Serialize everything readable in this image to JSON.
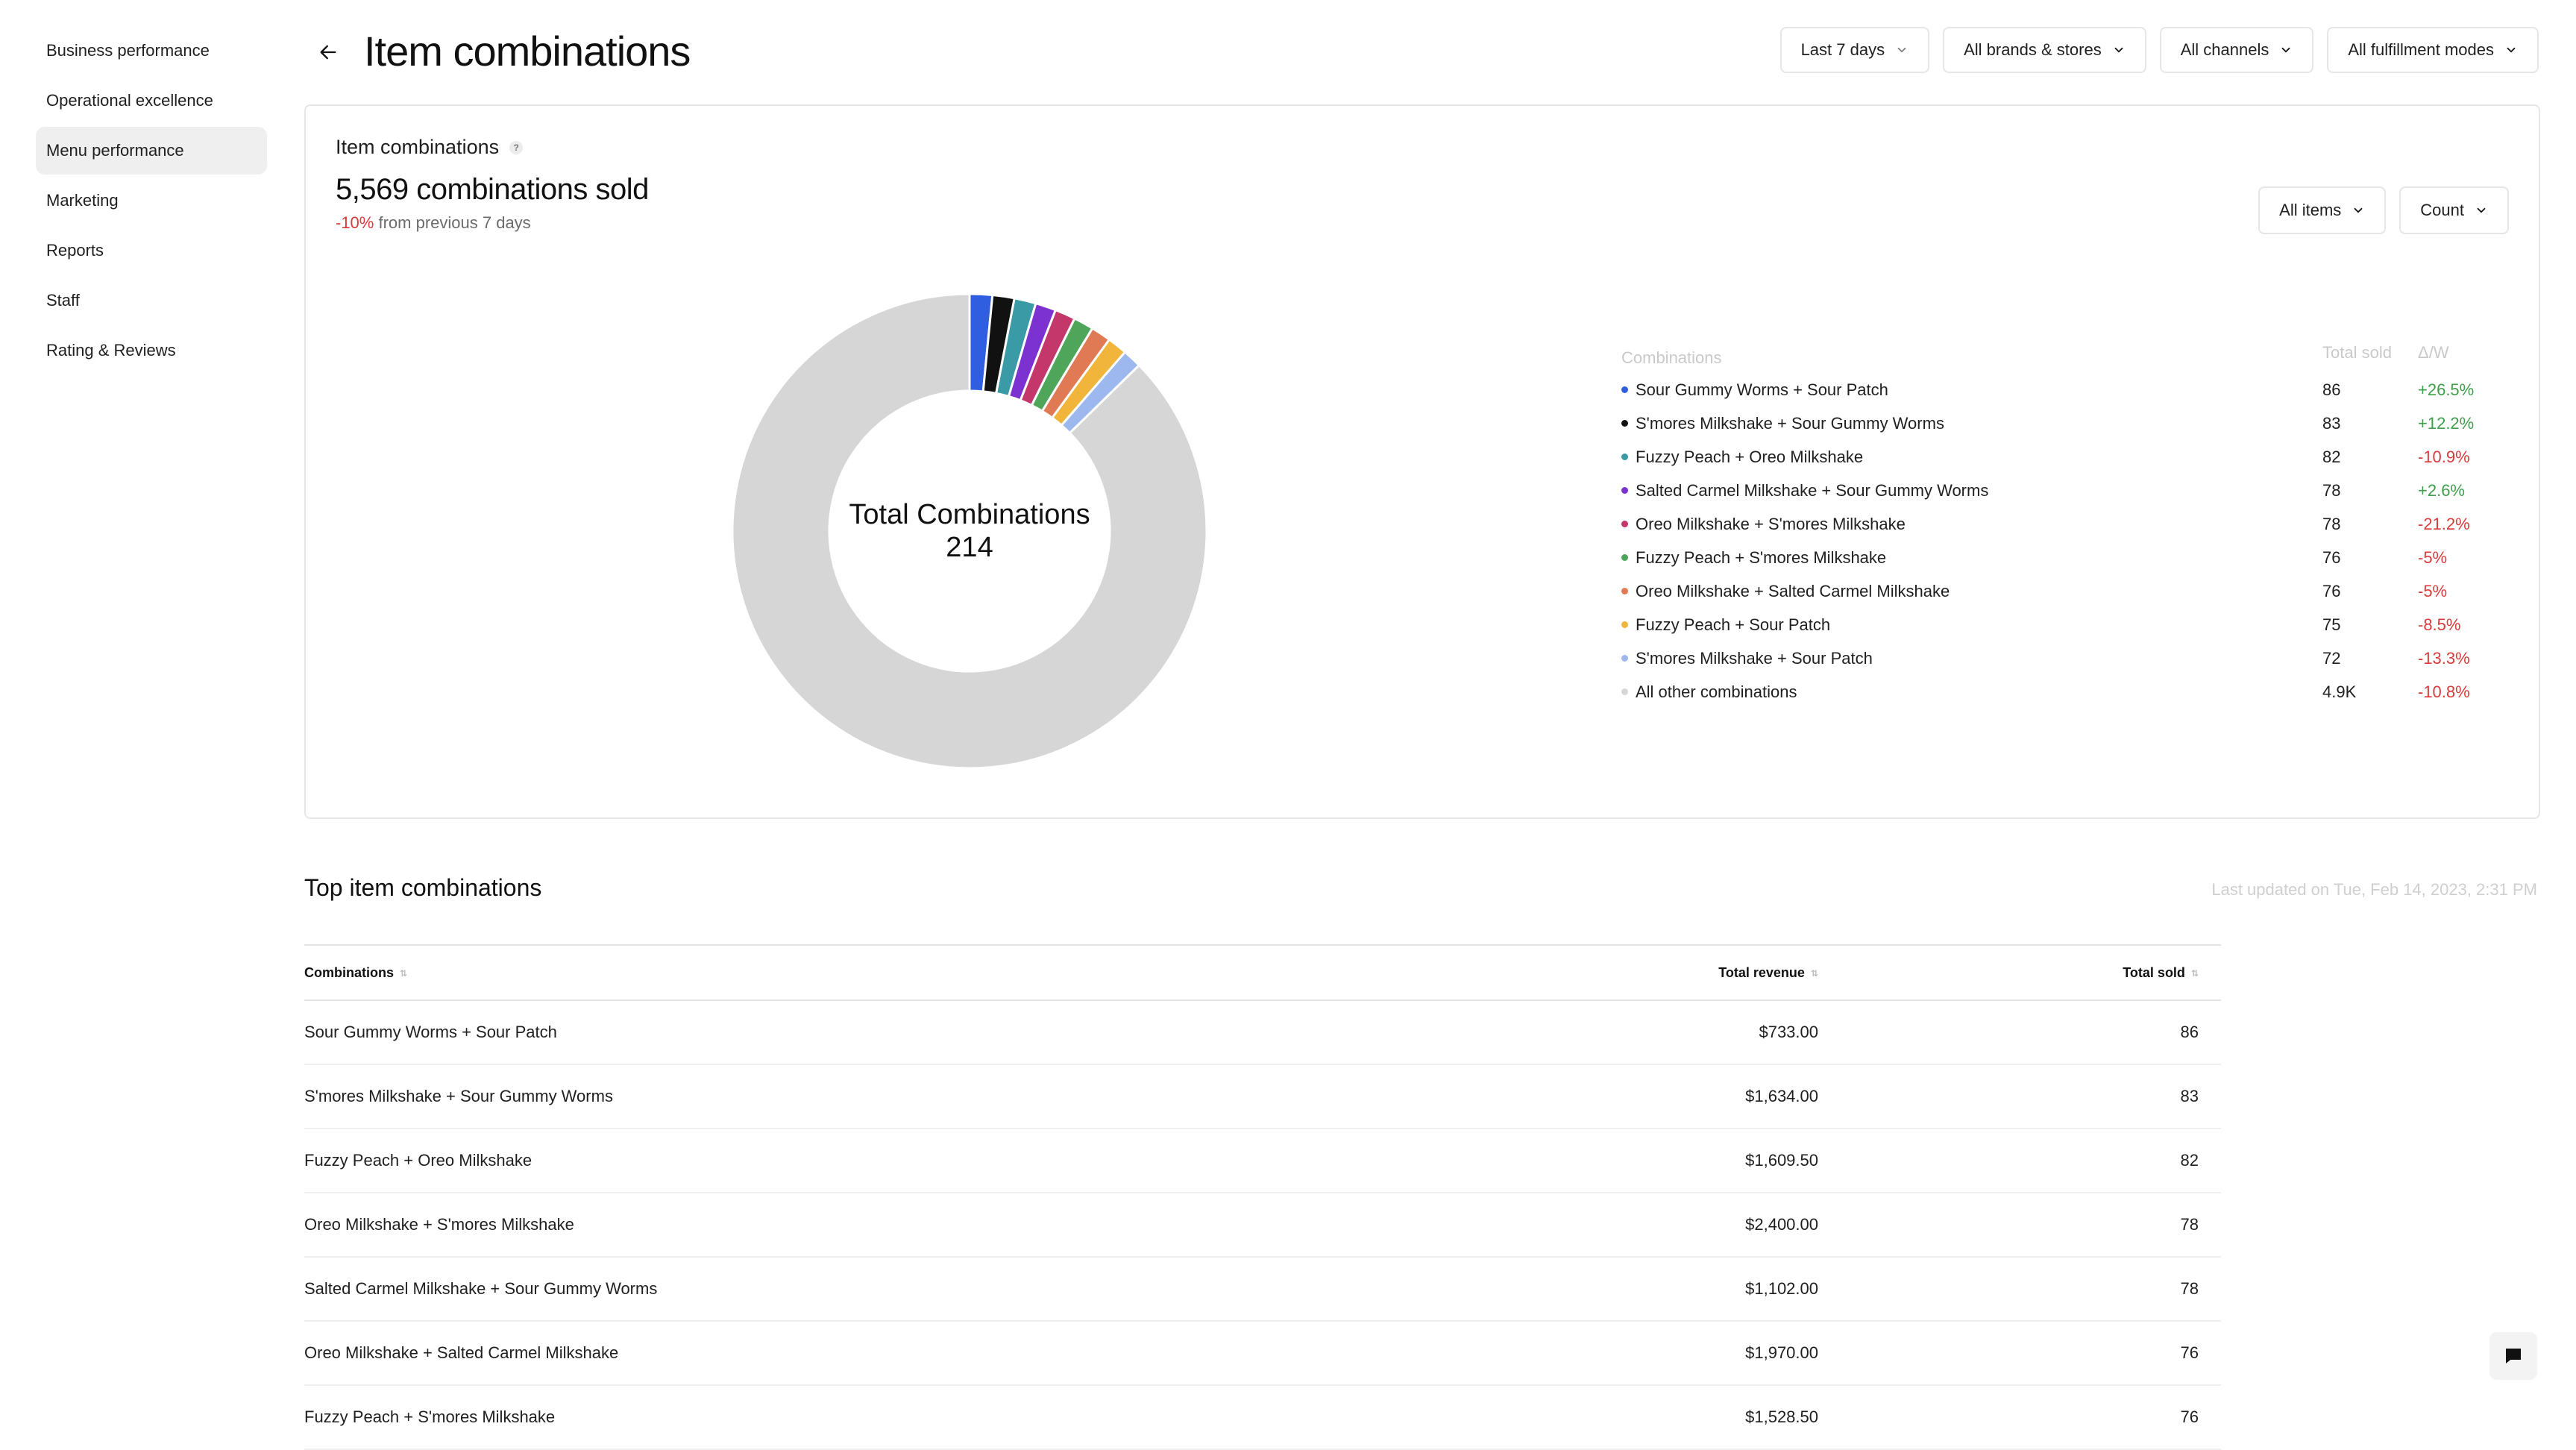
{
  "sidebar": {
    "items": [
      {
        "label": "Business performance"
      },
      {
        "label": "Operational excellence"
      },
      {
        "label": "Menu performance",
        "active": true
      },
      {
        "label": "Marketing"
      },
      {
        "label": "Reports"
      },
      {
        "label": "Staff"
      },
      {
        "label": "Rating & Reviews"
      }
    ]
  },
  "header": {
    "title": "Item combinations",
    "filters": [
      "Last 7 days",
      "All brands & stores",
      "All channels",
      "All fulfillment modes"
    ]
  },
  "card": {
    "title": "Item combinations",
    "help_icon": "question-icon",
    "headline": "5,569 combinations sold",
    "change": "-10%",
    "change_suffix": "from previous 7 days",
    "controls": [
      "All items",
      "Count"
    ],
    "donut": {
      "center_label": "Total Combinations",
      "center_value": "214"
    },
    "legend": {
      "headers": {
        "name": "Combinations",
        "sold": "Total sold",
        "delta": "Δ/W"
      },
      "rows": [
        {
          "name": "Sour Gummy Worms + Sour Patch",
          "sold": "86",
          "delta": "+26.5%",
          "color": "#2f5fe0",
          "value": 86
        },
        {
          "name": "S'mores Milkshake + Sour Gummy Worms",
          "sold": "83",
          "delta": "+12.2%",
          "color": "#111111",
          "value": 83
        },
        {
          "name": "Fuzzy Peach + Oreo Milkshake",
          "sold": "82",
          "delta": "-10.9%",
          "color": "#3a9aa6",
          "value": 82
        },
        {
          "name": "Salted Carmel Milkshake + Sour Gummy Worms",
          "sold": "78",
          "delta": "+2.6%",
          "color": "#7b32d0",
          "value": 78
        },
        {
          "name": "Oreo Milkshake + S'mores Milkshake",
          "sold": "78",
          "delta": "-21.2%",
          "color": "#c4376b",
          "value": 78
        },
        {
          "name": "Fuzzy Peach + S'mores Milkshake",
          "sold": "76",
          "delta": "-5%",
          "color": "#4fa65a",
          "value": 76
        },
        {
          "name": "Oreo Milkshake + Salted Carmel Milkshake",
          "sold": "76",
          "delta": "-5%",
          "color": "#e07a55",
          "value": 76
        },
        {
          "name": "Fuzzy Peach + Sour Patch",
          "sold": "75",
          "delta": "-8.5%",
          "color": "#f2b53c",
          "value": 75
        },
        {
          "name": "S'mores Milkshake + Sour Patch",
          "sold": "72",
          "delta": "-13.3%",
          "color": "#9db8ef",
          "value": 72
        },
        {
          "name": "All other combinations",
          "sold": "4.9K",
          "delta": "-10.8%",
          "color": "#d6d6d6",
          "value": 4863
        }
      ]
    }
  },
  "table": {
    "section_title": "Top item combinations",
    "updated": "Last updated on Tue, Feb 14, 2023, 2:31 PM",
    "headers": [
      "Combinations",
      "Total revenue",
      "Total sold"
    ],
    "rows": [
      [
        "Sour Gummy Worms + Sour Patch",
        "$733.00",
        "86"
      ],
      [
        "S'mores Milkshake + Sour Gummy Worms",
        "$1,634.00",
        "83"
      ],
      [
        "Fuzzy Peach + Oreo Milkshake",
        "$1,609.50",
        "82"
      ],
      [
        "Oreo Milkshake + S'mores Milkshake",
        "$2,400.00",
        "78"
      ],
      [
        "Salted Carmel Milkshake + Sour Gummy Worms",
        "$1,102.00",
        "78"
      ],
      [
        "Oreo Milkshake + Salted Carmel Milkshake",
        "$1,970.00",
        "76"
      ],
      [
        "Fuzzy Peach + S'mores Milkshake",
        "$1,528.50",
        "76"
      ]
    ]
  },
  "icons": {
    "back": "arrow-left-icon",
    "chevron": "chevron-down-icon",
    "chat": "chat-icon"
  }
}
